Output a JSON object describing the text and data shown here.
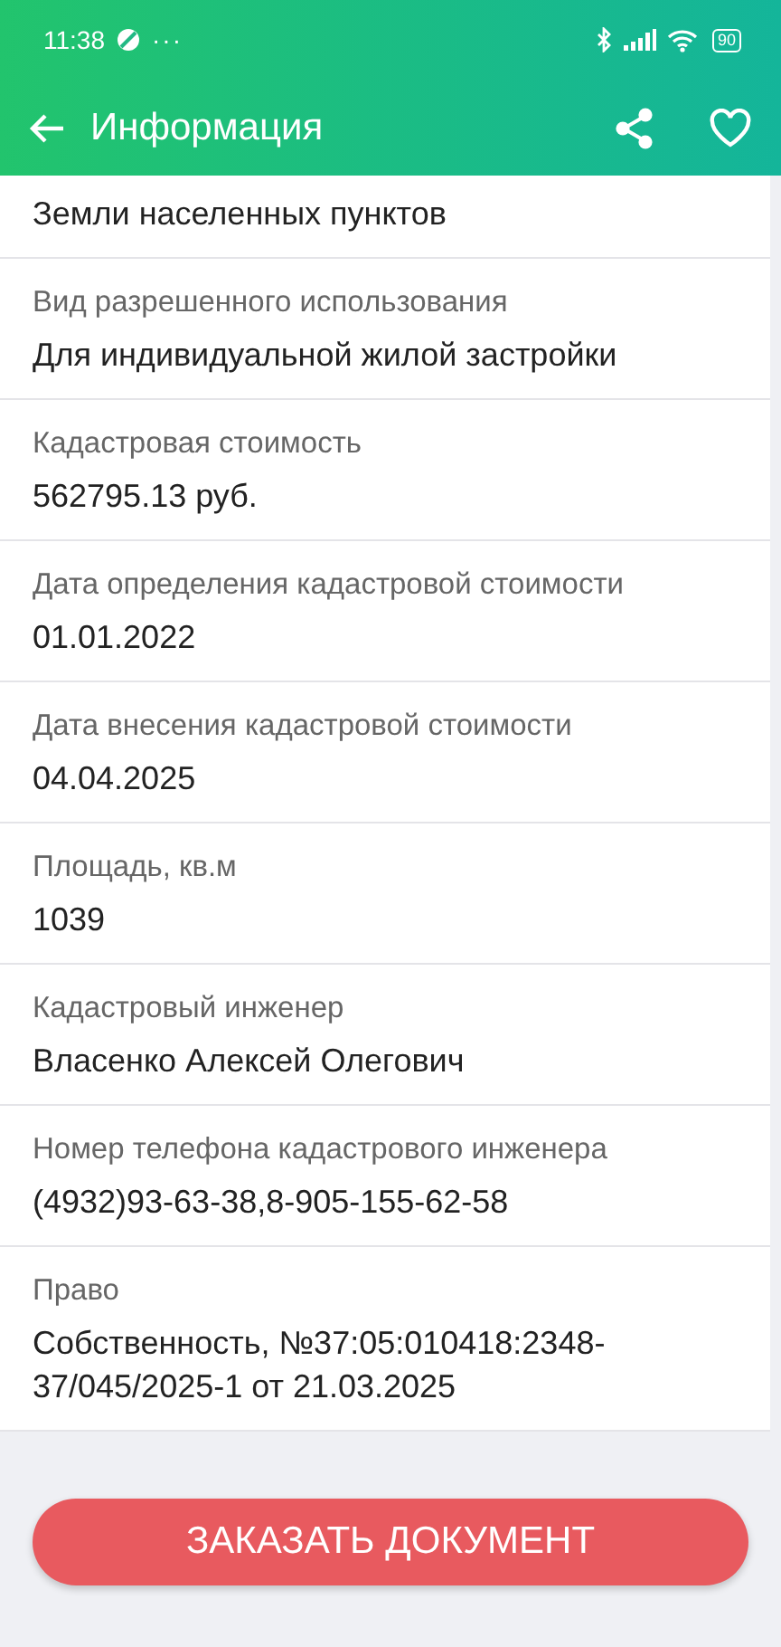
{
  "status_bar": {
    "time": "11:38",
    "dots": "···",
    "battery": "90"
  },
  "app_bar": {
    "title": "Информация"
  },
  "fields": [
    {
      "value": "Земли населенных пунктов"
    },
    {
      "label": "Вид разрешенного использования",
      "value": "Для индивидуальной жилой застройки"
    },
    {
      "label": "Кадастровая стоимость",
      "value": "562795.13 руб."
    },
    {
      "label": "Дата определения кадастровой стоимости",
      "value": "01.01.2022"
    },
    {
      "label": "Дата внесения кадастровой стоимости",
      "value": "04.04.2025"
    },
    {
      "label": "Площадь, кв.м",
      "value": "1039"
    },
    {
      "label": "Кадастровый инженер",
      "value": "Власенко Алексей Олегович"
    },
    {
      "label": "Номер телефона кадастрового инженера",
      "value": "(4932)93-63-38,8-905-155-62-58"
    },
    {
      "label": "Право",
      "value": "Собственность, №37:05:010418:2348-37/045/2025-1 от 21.03.2025"
    }
  ],
  "order_button": {
    "label": "ЗАКАЗАТЬ ДОКУМЕНТ"
  }
}
